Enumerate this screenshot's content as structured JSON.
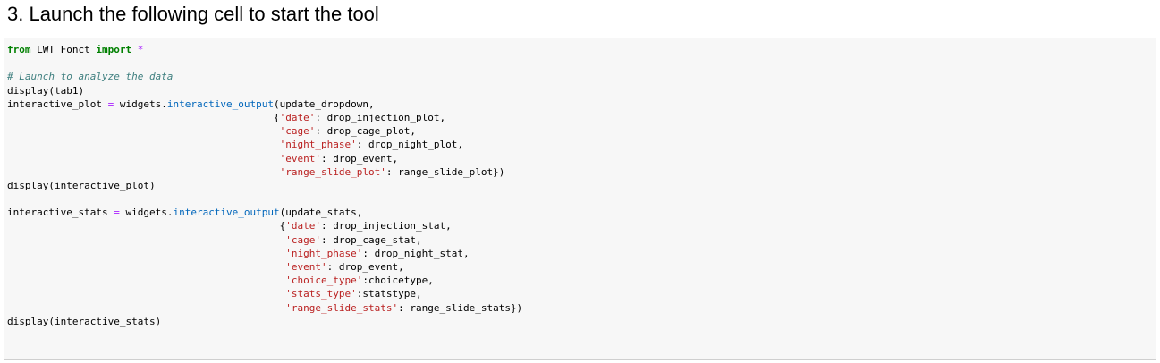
{
  "heading": "3. Launch the following cell to start the tool",
  "code": {
    "import_from_kw": "from",
    "import_module": " LWT_Fonct ",
    "import_kw": "import",
    "import_star": "*",
    "comment": "# Launch to analyze the data",
    "display_tab1": "display(tab1)",
    "plot_var": "interactive_plot",
    "stats_var": "interactive_stats",
    "assign_eq": "=",
    "widgets_prefix": "widgets.",
    "interactive_output_fn": "interactive_output",
    "update_dropdown": "(update_dropdown,",
    "update_stats": "(update_stats,",
    "plot_dict": [
      {
        "key": "'date'",
        "value": ": drop_injection_plot,"
      },
      {
        "key": "'cage'",
        "value": ": drop_cage_plot,"
      },
      {
        "key": "'night_phase'",
        "value": ": drop_night_plot,"
      },
      {
        "key": "'event'",
        "value": ": drop_event,"
      },
      {
        "key": "'range_slide_plot'",
        "value": ": range_slide_plot})"
      }
    ],
    "stats_dict": [
      {
        "key": "'date'",
        "value": ": drop_injection_stat,"
      },
      {
        "key": "'cage'",
        "value": ": drop_cage_stat,"
      },
      {
        "key": "'night_phase'",
        "value": ": drop_night_stat,"
      },
      {
        "key": "'event'",
        "value": ": drop_event,"
      },
      {
        "key": "'choice_type'",
        "value": ":choicetype,"
      },
      {
        "key": "'stats_type'",
        "value": ":statstype,"
      },
      {
        "key": "'range_slide_stats'",
        "value": ": range_slide_stats})"
      }
    ],
    "display_plot": "display(interactive_plot)",
    "display_stats": "display(interactive_stats)"
  }
}
